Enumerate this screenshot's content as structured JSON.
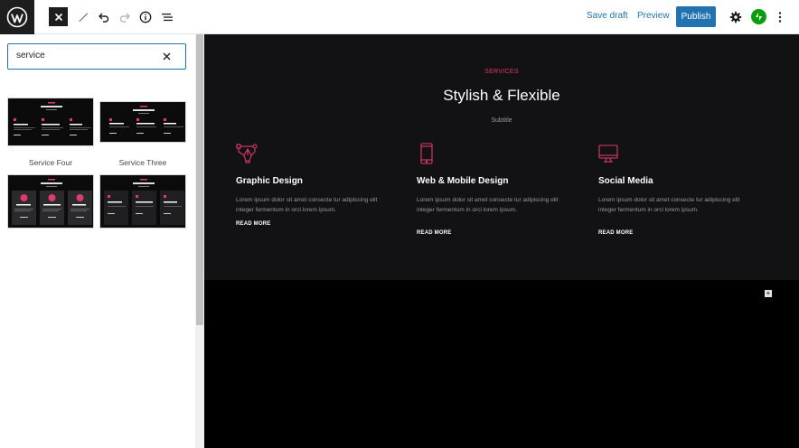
{
  "toolbar": {
    "save_draft": "Save draft",
    "preview": "Preview",
    "publish": "Publish",
    "icons": [
      "wordpress-icon",
      "close-icon",
      "pencil-icon",
      "undo-icon",
      "redo-icon",
      "info-icon",
      "list-view-icon",
      "gear-icon",
      "jetpack-icon",
      "more-vertical-icon"
    ]
  },
  "inserter": {
    "search_value": "service",
    "patterns": [
      {
        "label": "Service Four"
      },
      {
        "label": "Service Three"
      },
      {
        "label": ""
      },
      {
        "label": ""
      }
    ]
  },
  "section": {
    "eyebrow": "SERVICES",
    "heading": "Stylish & Flexible",
    "subtitle": "Subtitle",
    "columns": [
      {
        "icon": "vector-pen-icon",
        "title": "Graphic Design",
        "text": "Lorem ipsum dolor sit amet consecte tur adipiscing elit integer fermentum in orci lorem ipsum.",
        "link": "READ MORE"
      },
      {
        "icon": "mobile-phone-icon",
        "title": "Web & Mobile Design",
        "text": "Lorem ipsum dolor sit amet consecte tur adipiscing elit integer fermentum in orci lorem ipsum.",
        "link": "READ MORE"
      },
      {
        "icon": "monitor-icon",
        "title": "Social Media",
        "text": "Lorem ipsum dolor sit amet consecte tur adipiscing elit integer fermentum in orci lorem ipsum.",
        "link": "READ MORE"
      }
    ]
  },
  "colors": {
    "accent": "#e03a6b",
    "primary": "#2271b1",
    "canvas_bg": "#121113",
    "jetpack": "#069e08"
  }
}
